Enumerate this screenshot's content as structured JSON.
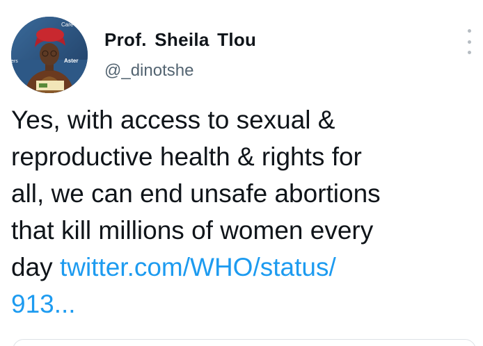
{
  "tweet": {
    "display_name": "Prof. Sheila Tlou",
    "handle": "@_dinotshe",
    "text_lines": [
      "Yes, with access to sexual &",
      "reproductive health & rights for",
      "all, we can end unsafe abortions",
      "that kill millions of women every"
    ],
    "last_line_prefix": "day ",
    "link_part1": "twitter.com/WHO/status/",
    "link_part2": "913..."
  },
  "avatar_overlay_text": {
    "top_right": "Care",
    "left": "ers",
    "right": "Aster"
  },
  "icons": {
    "more": "more-options-icon"
  },
  "colors": {
    "text": "#0f1419",
    "secondary": "#536471",
    "link": "#1d9bf0"
  }
}
